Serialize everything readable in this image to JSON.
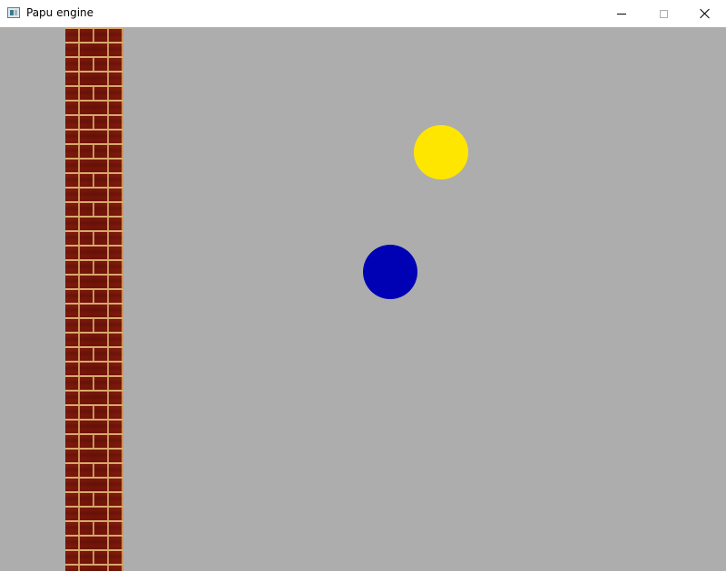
{
  "window": {
    "title": "Papu engine",
    "icon": "application-window-icon",
    "controls": {
      "minimize": "minimize-icon",
      "maximize": "maximize-icon",
      "close": "close-icon"
    }
  },
  "scene": {
    "background_color": "#adadad",
    "objects": [
      {
        "kind": "brick-wall",
        "texture": "red-brick"
      },
      {
        "kind": "ball",
        "color": "#ffe600"
      },
      {
        "kind": "ball",
        "color": "#0000b4"
      }
    ]
  }
}
